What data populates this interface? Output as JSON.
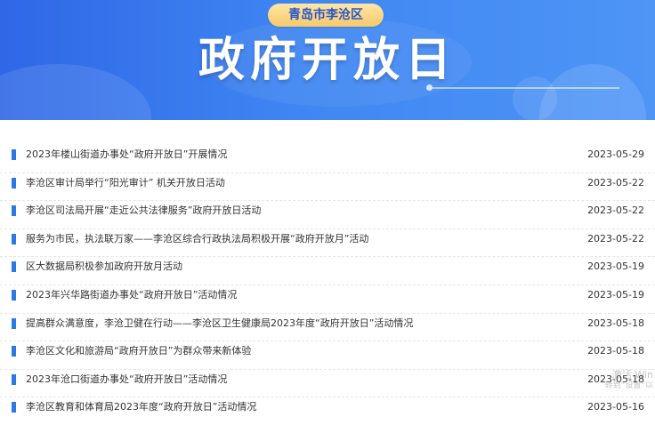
{
  "banner": {
    "city_label": "青岛市李沧区",
    "main_title": "政府开放日"
  },
  "news_list": [
    {
      "title": "2023年楼山街道办事处“政府开放日”开展情况",
      "date": "2023-05-29"
    },
    {
      "title": "李沧区审计局举行“阳光审计” 机关开放日活动",
      "date": "2023-05-22"
    },
    {
      "title": "李沧区司法局开展“走近公共法律服务”政府开放日活动",
      "date": "2023-05-22"
    },
    {
      "title": "服务为市民，执法联万家——李沧区综合行政执法局积极开展“政府开放月”活动",
      "date": "2023-05-22"
    },
    {
      "title": "区大数据局积极参加政府开放月活动",
      "date": "2023-05-19"
    },
    {
      "title": "2023年兴华路街道办事处“政府开放日”活动情况",
      "date": "2023-05-19"
    },
    {
      "title": "提高群众满意度，李沧卫健在行动——李沧区卫生健康局2023年度“政府开放日”活动情况",
      "date": "2023-05-18"
    },
    {
      "title": "李沧区文化和旅游局“政府开放日”为群众带来新体验",
      "date": "2023-05-18"
    },
    {
      "title": "2023年沧口街道办事处“政府开放日”活动情况",
      "date": "2023-05-18"
    },
    {
      "title": "李沧区教育和体育局2023年度“政府开放日”活动情况",
      "date": "2023-05-16"
    }
  ],
  "watermark": {
    "line1": "激活 Win",
    "line2": "转到“设置”以"
  },
  "colors": {
    "banner_blue": "#3f86f2",
    "pill_gold": "#f7c96a",
    "bullet_blue": "#2a7ae2",
    "text": "#333333"
  }
}
